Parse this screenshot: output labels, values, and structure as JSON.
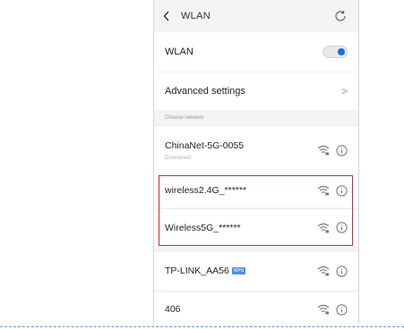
{
  "topbar": {
    "title": "WLAN"
  },
  "wlan_row": {
    "label": "WLAN",
    "enabled": true
  },
  "advanced_row": {
    "label": "Advanced settings",
    "chevron": ">"
  },
  "section_header": "Choose network",
  "networks": [
    {
      "name": "ChinaNet-5G-0055",
      "status": "Connected",
      "badge": ""
    },
    {
      "name": "wireless2.4G_******",
      "status": "",
      "badge": ""
    },
    {
      "name": "Wireless5G_******",
      "status": "",
      "badge": ""
    },
    {
      "name": "TP-LINK_AA56",
      "status": "",
      "badge": "WPS"
    },
    {
      "name": "406",
      "status": "",
      "badge": ""
    }
  ],
  "colors": {
    "accent": "#1e6fe0",
    "highlight_border": "#d6252f",
    "dashed_line": "#5b9bd5"
  },
  "icons": [
    "back-arrow-icon",
    "refresh-icon",
    "chevron-right-icon",
    "wifi-lock-icon",
    "info-icon"
  ]
}
